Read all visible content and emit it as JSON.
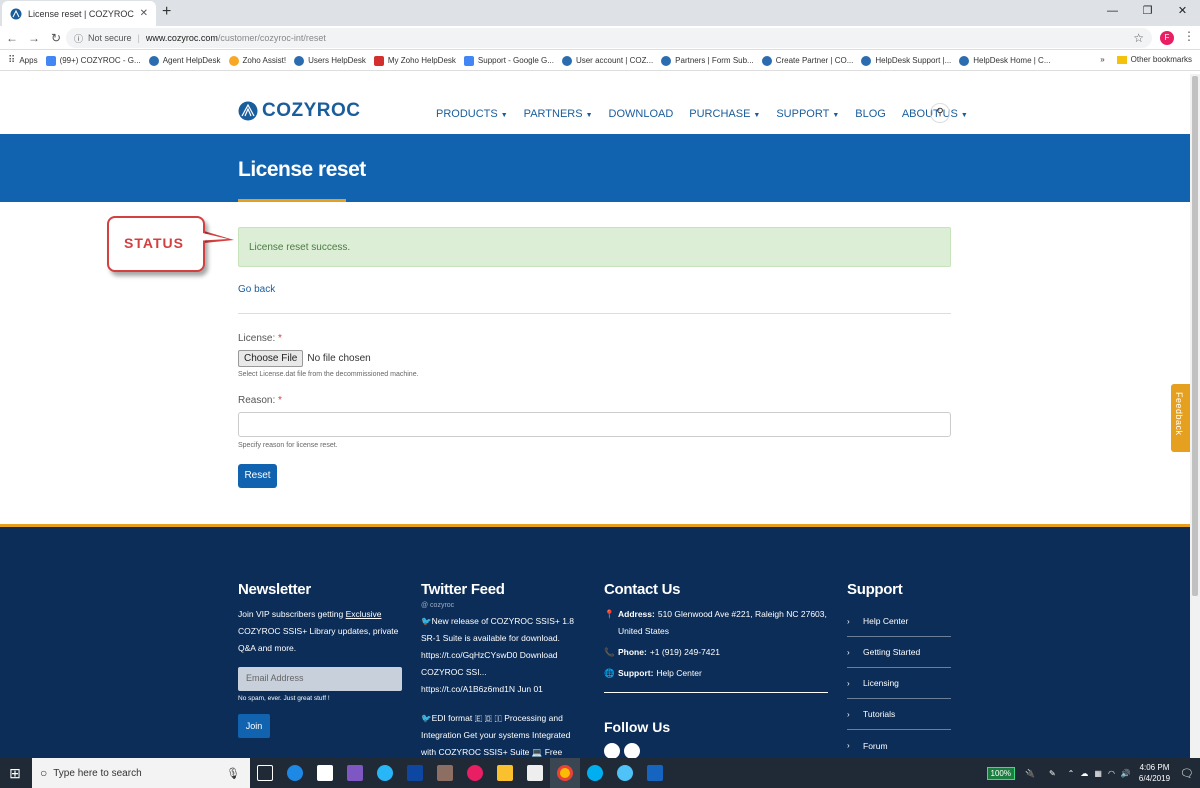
{
  "browser": {
    "tab_title": "License reset | COZYROC",
    "tab_close": "✕",
    "new_tab": "+",
    "not_secure": "Not secure",
    "url_host": "www.cozyroc.com",
    "url_path": "/customer/cozyroc-int/reset",
    "profile_initial": "F",
    "bookmarks": [
      "Apps",
      "(99+) COZYROC - G...",
      "Agent HelpDesk",
      "Zoho Assist!",
      "Users HelpDesk",
      "My Zoho HelpDesk",
      "Support - Google G...",
      "User account | COZ...",
      "Partners | Form Sub...",
      "Create Partner | CO...",
      "HelpDesk Support |...",
      "HelpDesk Home | C..."
    ],
    "overflow": "»",
    "other_bookmarks": "Other bookmarks"
  },
  "site": {
    "logo_text": "COZYROC",
    "nav": [
      {
        "label": "PRODUCTS",
        "caret": true
      },
      {
        "label": "PARTNERS",
        "caret": true
      },
      {
        "label": "DOWNLOAD",
        "caret": false
      },
      {
        "label": "PURCHASE",
        "caret": true
      },
      {
        "label": "SUPPORT",
        "caret": true
      },
      {
        "label": "BLOG",
        "caret": false
      },
      {
        "label": "ABOUT US",
        "caret": true
      }
    ],
    "page_title": "License reset"
  },
  "callout": {
    "label": "STATUS"
  },
  "main": {
    "status_message": "License reset success.",
    "go_back": "Go back",
    "license_label": "License:",
    "required_mark": "*",
    "choose_file": "Choose File",
    "no_file": "No file chosen",
    "license_hint": "Select License.dat file from the decommissioned machine.",
    "reason_label": "Reason:",
    "reason_value": "",
    "reason_hint": "Specify reason for license reset.",
    "reset_button": "Reset",
    "feedback": "Feedback"
  },
  "footer": {
    "newsletter": {
      "title": "Newsletter",
      "text_before": "Join VIP subscribers getting ",
      "text_link": "Exclusive",
      "text_after": " COZYROC SSIS+ Library updates, private Q&A and more.",
      "email_placeholder": "Email Address",
      "no_spam": "No spam, ever. Just great stuff !",
      "join": "Join"
    },
    "twitter": {
      "title": "Twitter Feed",
      "handle": "@ cozyroc",
      "tweet1": "New release of COZYROC SSIS+ 1.8 SR-1 Suite is available for download. https://t.co/GqHzCYswD0 Download COZYROC SSI... https://t.co/A1B6z6md1N Jun 01",
      "tweet2": "EDI format 🇪 🇩 🇮 Processing and Integration Get your systems Integrated with COZYROC SSIS+ Suite 💻 Free"
    },
    "contact": {
      "title": "Contact Us",
      "address_label": "Address:",
      "address": "510 Glenwood Ave #221, Raleigh NC 27603, United States",
      "phone_label": "Phone:",
      "phone": "+1 (919) 249-7421",
      "support_label": "Support:",
      "support": "Help Center",
      "follow": "Follow Us"
    },
    "support": {
      "title": "Support",
      "items": [
        "Help Center",
        "Getting Started",
        "Licensing",
        "Tutorials",
        "Forum"
      ]
    }
  },
  "taskbar": {
    "search_placeholder": "Type here to search",
    "battery": "100%",
    "time": "4:06 PM",
    "date": "6/4/2019"
  }
}
